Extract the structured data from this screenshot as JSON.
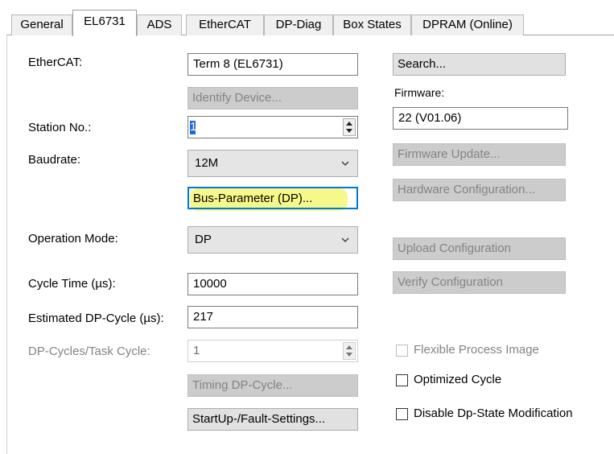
{
  "tabs": [
    "General",
    "EL6731",
    "ADS",
    "EtherCAT",
    "DP-Diag",
    "Box States",
    "DPRAM (Online)"
  ],
  "labels": {
    "ethercat": "EtherCAT:",
    "station_no": "Station No.:",
    "baudrate": "Baudrate:",
    "operation_mode": "Operation Mode:",
    "cycle_time": "Cycle Time (µs):",
    "estimated_dp_cycle": "Estimated DP-Cycle (µs):",
    "dp_cycles_task_cycle": "DP-Cycles/Task Cycle:",
    "firmware": "Firmware:"
  },
  "fields": {
    "ethercat_value": "Term 8 (EL6731)",
    "station_no_value": "1",
    "baudrate_value": "12M",
    "operation_mode_value": "DP",
    "cycle_time_value": "10000",
    "estimated_dp_cycle_value": "217",
    "dp_cycles_task_cycle_value": "1",
    "firmware_value": "22 (V01.06)"
  },
  "buttons": {
    "identify_device": "Identify Device...",
    "bus_parameter": "Bus-Parameter (DP)...",
    "timing_dp_cycle": "Timing DP-Cycle...",
    "startup_fault_settings": "StartUp-/Fault-Settings...",
    "search": "Search...",
    "firmware_update": "Firmware Update...",
    "hardware_configuration": "Hardware Configuration...",
    "upload_configuration": "Upload Configuration",
    "verify_configuration": "Verify Configuration"
  },
  "checkboxes": {
    "flexible_process_image": "Flexible Process Image",
    "optimized_cycle": "Optimized Cycle",
    "disable_dp_state_modification": "Disable Dp-State Modification"
  }
}
